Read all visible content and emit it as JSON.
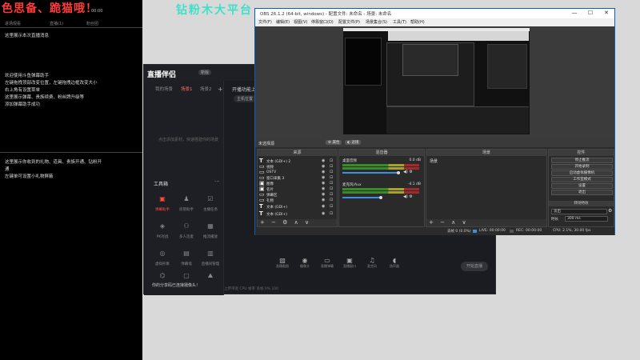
{
  "banner": {
    "left_text": "色思备、跪猫哦！",
    "top_title": "钻粉木大平台"
  },
  "left_panel": {
    "stats": [
      {
        "value": "-",
        "label": "进场观看"
      },
      {
        "value": "-",
        "label": "直播(1)"
      },
      {
        "value": "00:00",
        "label": "粉丝团"
      }
    ],
    "lines_top": [
      "这里展示本次直播消息"
    ],
    "lines_mid": [
      "欢迎使用斗鱼弹幕助手",
      "左键拖拽顶部改变位置，左键拖拽边框改变大小",
      "右上角有设置菜单",
      "这里展示弹幕、贵族续费、粉丝牌升级等",
      "添加弹幕助手成功"
    ],
    "lines_bottom": [
      "这里展示你收到的礼物、道具、贵族开通、钻粉开",
      "通",
      "左键单可设置小礼物屏蔽"
    ]
  },
  "zbbl": {
    "logo": "直播伴侣",
    "version": "新版",
    "tabs": [
      "我的场景",
      "场景1",
      "场景2"
    ],
    "add": "+",
    "empty_text": "点击添加素材，快速搭建你的场景",
    "tools_title": "工具箱",
    "tools_more": "···",
    "tools": [
      {
        "icon": "▣",
        "label": "弹幕助手",
        "active": true
      },
      {
        "icon": "♟",
        "label": "房管助手",
        "active": false
      },
      {
        "icon": "☑",
        "label": "主播任务",
        "active": false
      },
      {
        "icon": "◈",
        "label": "PK对战",
        "active": false
      },
      {
        "icon": "⚇",
        "label": "多人连麦",
        "active": false
      },
      {
        "icon": "▦",
        "label": "推流播放",
        "active": false
      },
      {
        "icon": "◎",
        "label": "虚拟形象",
        "active": false
      },
      {
        "icon": "▤",
        "label": "弹幕墙",
        "active": false
      },
      {
        "icon": "▥",
        "label": "直播间管理",
        "active": false
      },
      {
        "icon": "⌬",
        "label": "弹幕投屏",
        "active": false
      },
      {
        "icon": "▢",
        "label": "助手工具",
        "active": false
      },
      {
        "icon": "⛰",
        "label": "画面管理",
        "active": false
      }
    ],
    "notice_left": "你的分享码已连接摄像头！",
    "right_notice": "开播功能上线了",
    "subtab": "主机位置",
    "bottom_bar": [
      {
        "icon": "▨",
        "label": "直播截图"
      },
      {
        "icon": "◉",
        "label": "摄像头"
      },
      {
        "icon": "▭",
        "label": "直播弹幕"
      },
      {
        "icon": "▣",
        "label": "直播窗口"
      },
      {
        "icon": "♫",
        "label": "麦克风"
      },
      {
        "icon": "◖",
        "label": "扬声器"
      }
    ],
    "start_btn": "开始直播",
    "statusbar": "上传带宽  CPU  帧率  丢帧  0%  100"
  },
  "obs": {
    "title": "OBS 26.1.2 (64-bit, windows) - 配置文件: 未命名 - 场景: 未命名",
    "win_controls": [
      "—",
      "☐",
      "✕"
    ],
    "menu": [
      "文件(F)",
      "编辑(E)",
      "视图(V)",
      "停靠窗口(D)",
      "配置文件(P)",
      "场景集合(S)",
      "工具(T)",
      "帮助(H)"
    ],
    "scene_bar": {
      "name": "未选择源",
      "props": "⚙ 属性",
      "filters": "◐ 滤镜"
    },
    "docks": {
      "sources_title": "来源",
      "mixer_title": "混音器",
      "transitions_title": "场景",
      "controls_title": "控件"
    },
    "sources": [
      {
        "name": "文本 (GDI+) 2"
      },
      {
        "name": "视频"
      },
      {
        "name": "OSTV"
      },
      {
        "name": "窗口采集 3"
      },
      {
        "name": "图像"
      },
      {
        "name": "名片"
      },
      {
        "name": "弹幕区"
      },
      {
        "name": "礼物"
      },
      {
        "name": "文本 (GDI+)"
      },
      {
        "name": "文本 (GDI+)"
      }
    ],
    "sources_footer": "+ − ⚙ ∧ ∨",
    "mixer": [
      {
        "name": "桌面音频",
        "db": "0.0 dB"
      },
      {
        "name": "麦克风/Aux",
        "db": "-4.1 dB"
      }
    ],
    "mixer_icons": "◀) ⚙",
    "transitions_label": "场景",
    "transitions_footer": "+ − ∧ ∨",
    "controls": [
      "停止推流",
      "开始录制",
      "启动虚拟摄像机",
      "工作室模式",
      "设置",
      "退出"
    ],
    "controls_sub_title": "转场特效",
    "transition_select": "淡出",
    "duration_label": "时长",
    "duration_value": "300 ms",
    "statusbar": {
      "dropped": "丢帧 0 (0.0%)",
      "live": "LIVE: 00:00:00",
      "rec": "REC: 00:00:00",
      "cpu": "CPU: 2.1%, 30.00 fps"
    }
  },
  "colors": {
    "accent_red": "#ff4b3a",
    "title_cyan": "#3ee0c8",
    "obs_blue": "#0c5fb3"
  }
}
